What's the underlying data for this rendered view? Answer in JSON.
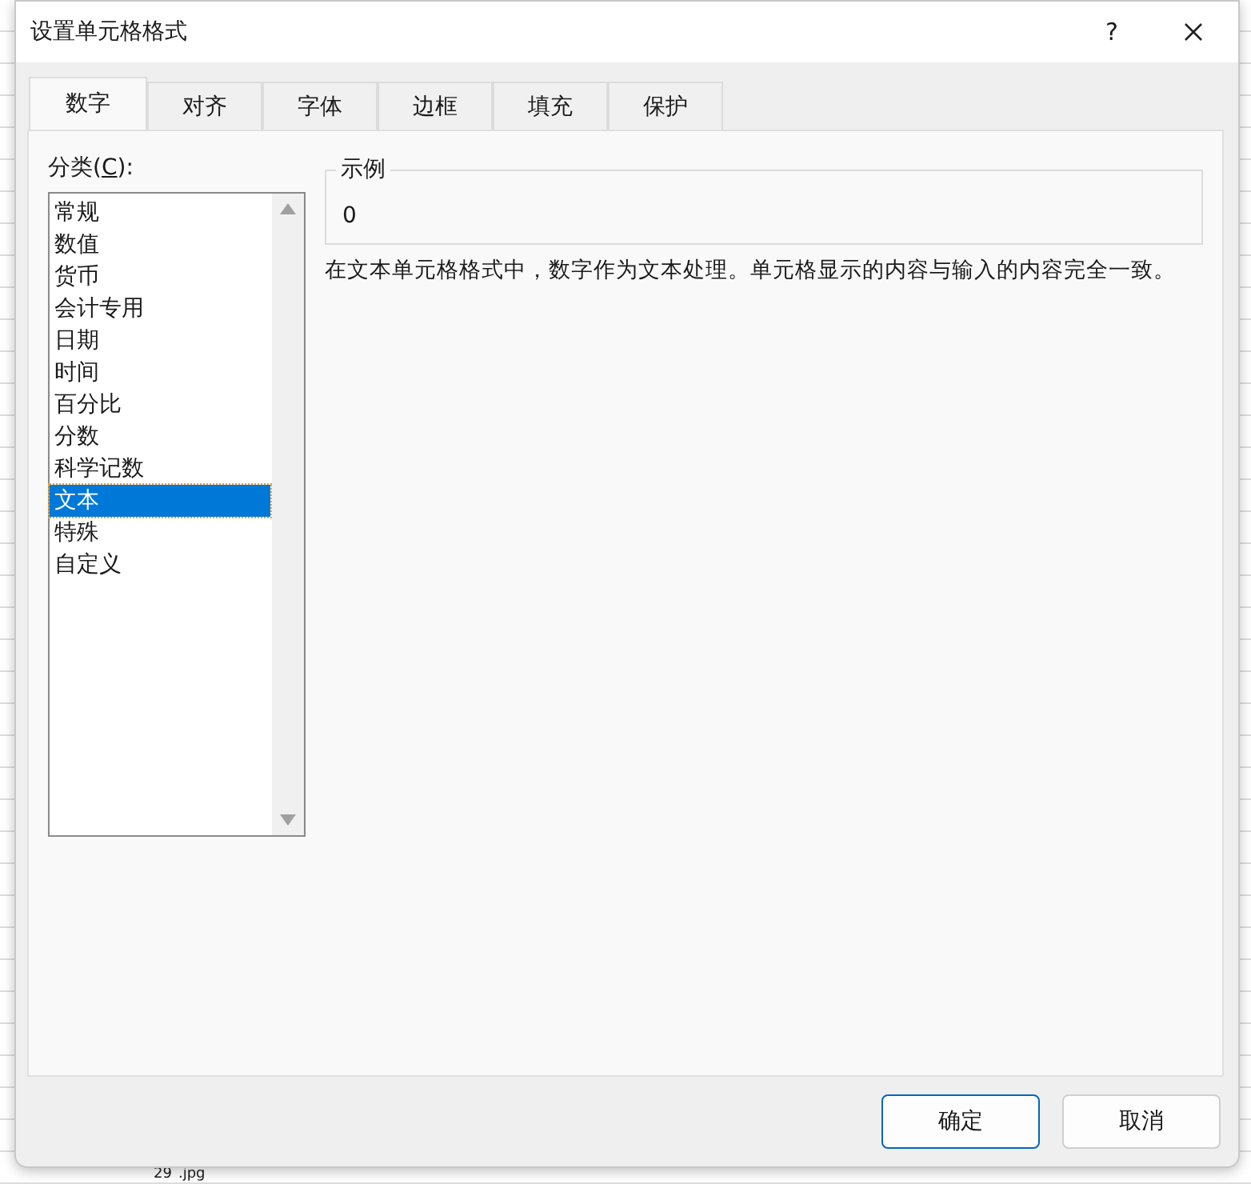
{
  "window": {
    "title": "设置单元格格式",
    "help": "?"
  },
  "tabs": [
    {
      "label": "数字",
      "selected": true
    },
    {
      "label": "对齐",
      "selected": false
    },
    {
      "label": "字体",
      "selected": false
    },
    {
      "label": "边框",
      "selected": false
    },
    {
      "label": "填充",
      "selected": false
    },
    {
      "label": "保护",
      "selected": false
    }
  ],
  "category": {
    "label": "分类(**C**):",
    "items": [
      {
        "label": "常规",
        "selected": false
      },
      {
        "label": "数值",
        "selected": false
      },
      {
        "label": "货币",
        "selected": false
      },
      {
        "label": "会计专用",
        "selected": false
      },
      {
        "label": "日期",
        "selected": false
      },
      {
        "label": "时间",
        "selected": false
      },
      {
        "label": "百分比",
        "selected": false
      },
      {
        "label": "分数",
        "selected": false
      },
      {
        "label": "科学记数",
        "selected": false
      },
      {
        "label": "文本",
        "selected": true
      },
      {
        "label": "特殊",
        "selected": false
      },
      {
        "label": "自定义",
        "selected": false
      }
    ]
  },
  "sample": {
    "label": "示例",
    "value": "0"
  },
  "description": "在文本单元格格式中，数字作为文本处理。单元格显示的内容与输入的内容完全一致。",
  "buttons": [
    "确定",
    "取消"
  ],
  "background_cells": [
    "29",
    ".jpg"
  ]
}
